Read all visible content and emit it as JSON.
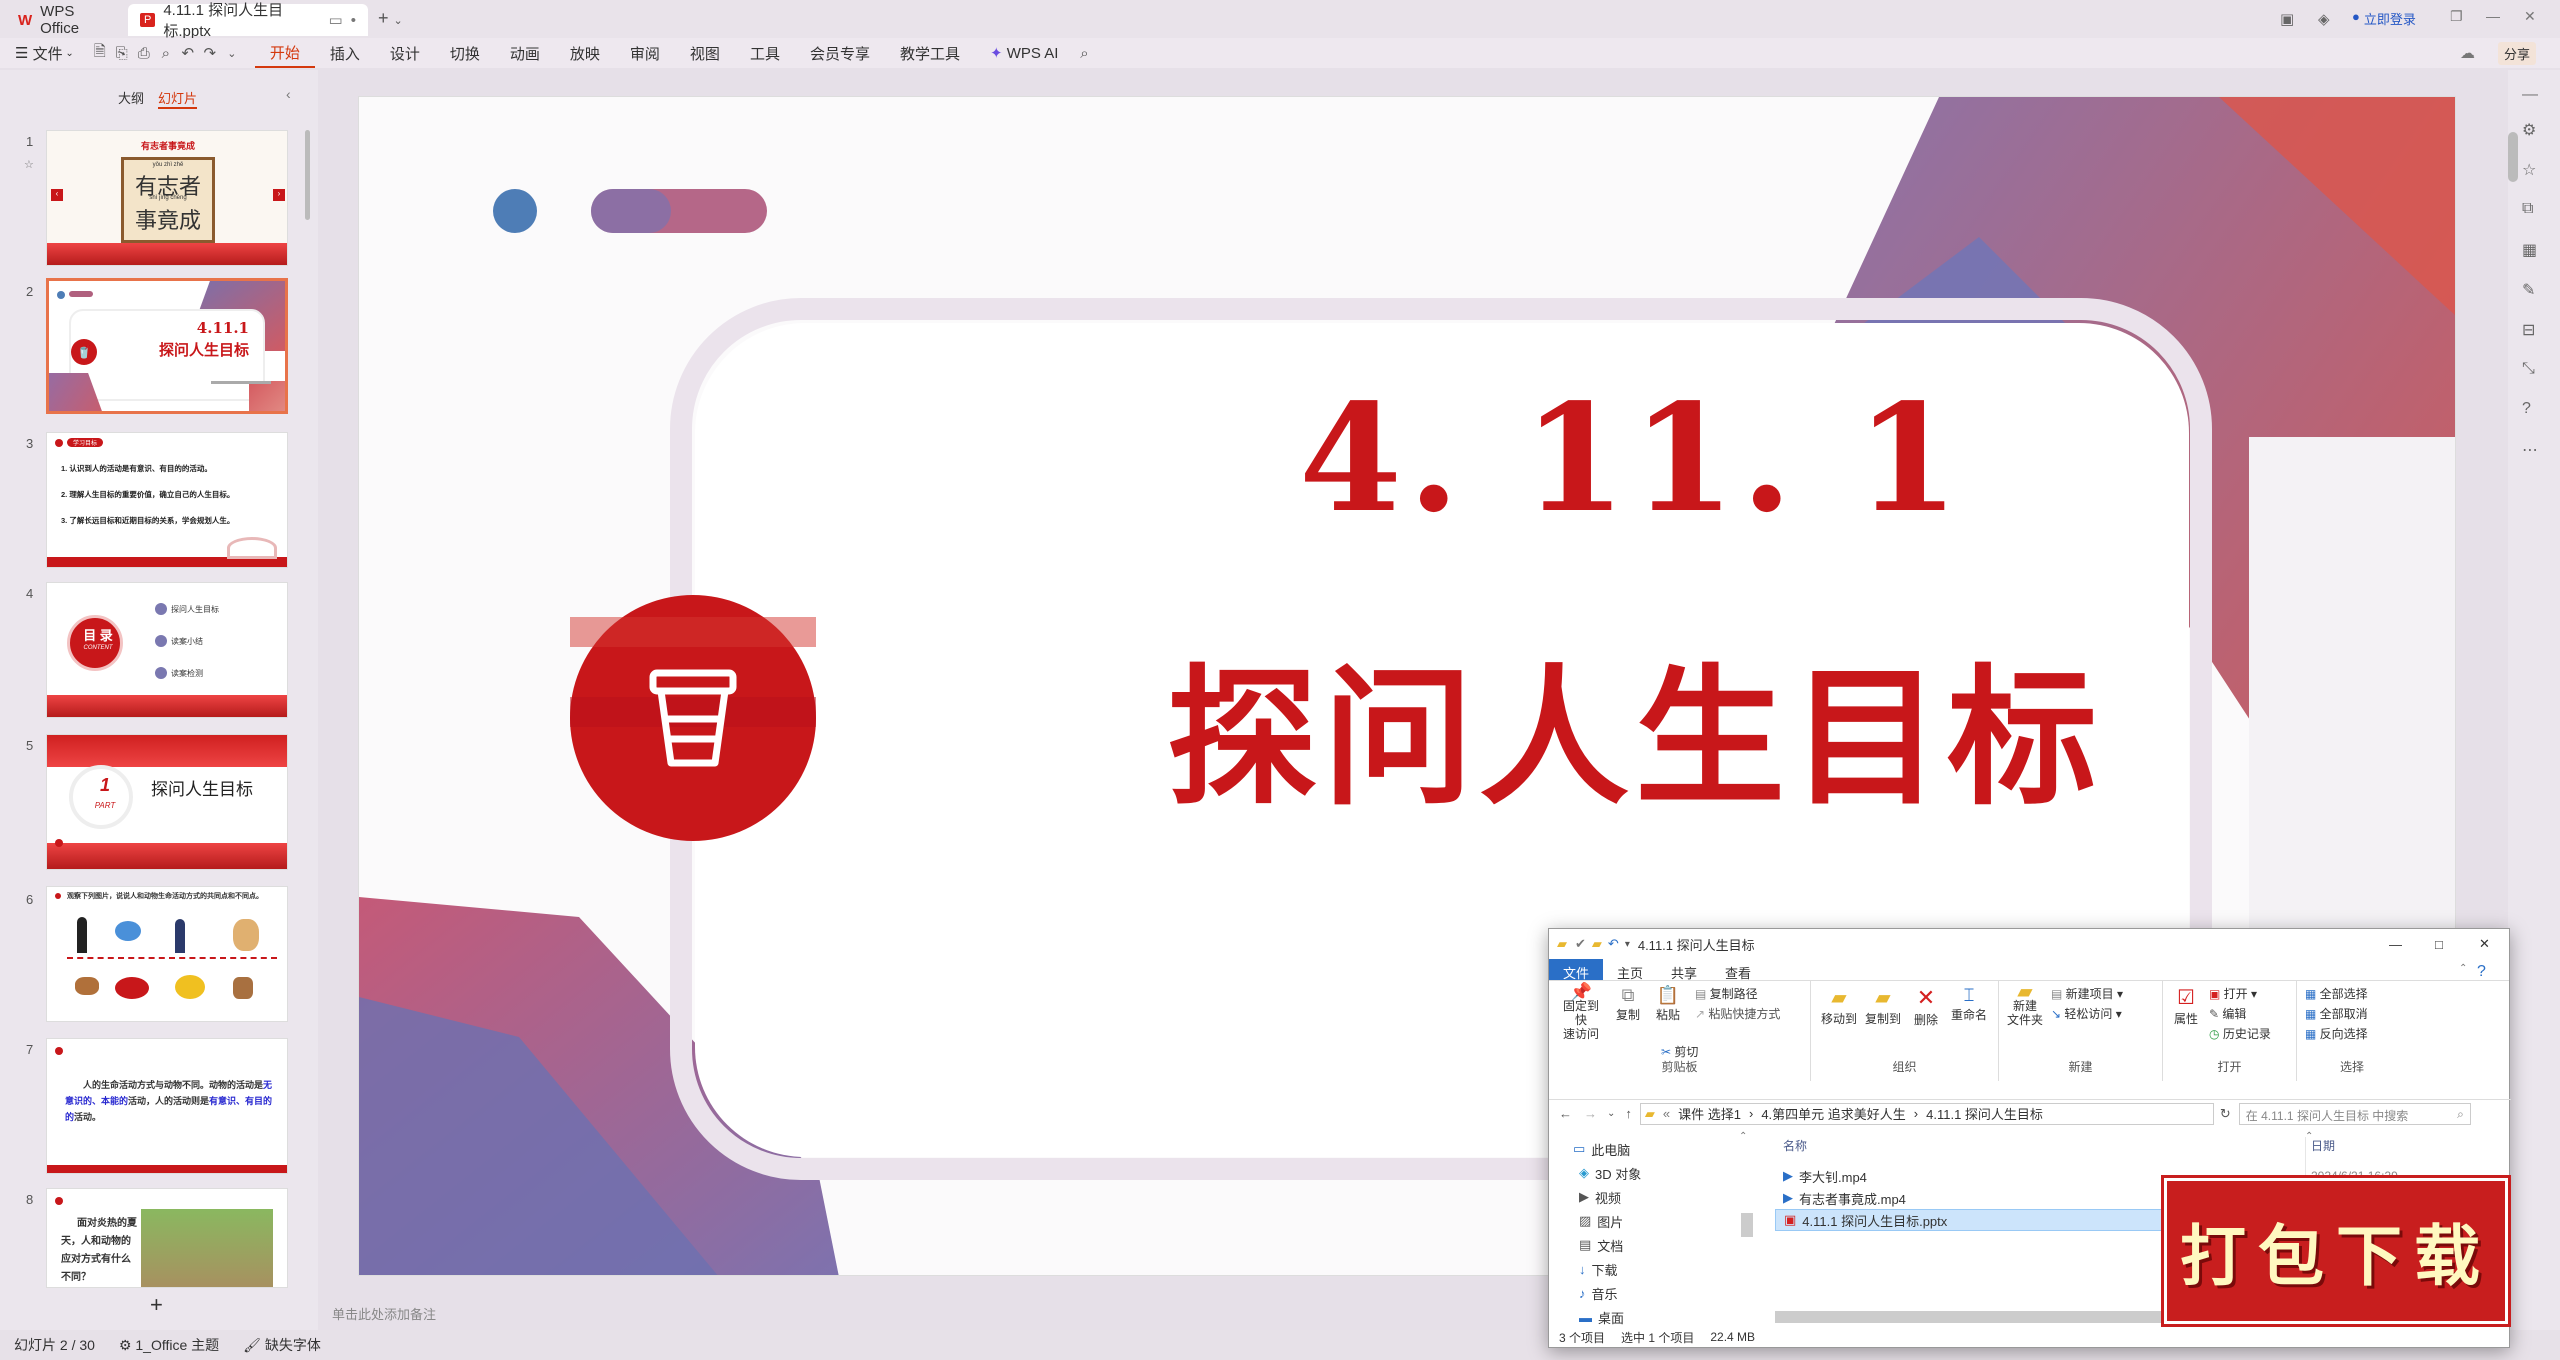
{
  "titlebar": {
    "app_tab": "WPS Office",
    "doc_tab": "4.11.1 探问人生目标.pptx",
    "login": "立即登录"
  },
  "ribbon": {
    "file": "文件",
    "tabs": [
      "开始",
      "插入",
      "设计",
      "切换",
      "动画",
      "放映",
      "审阅",
      "视图",
      "工具",
      "会员专享",
      "教学工具"
    ],
    "wps_ai": "WPS AI",
    "share": "分享"
  },
  "panel": {
    "outline": "大纲",
    "slides": "幻灯片",
    "add": "+"
  },
  "thumbs": [
    {
      "num": "1",
      "title": "有志者事竟成",
      "sub": "有志者",
      "sub2": "事竟成",
      "py": "yǒu zhì zhě",
      "py2": "shì jìng chéng"
    },
    {
      "num": "2",
      "t1": "4.11.1",
      "t2": "探问人生目标"
    },
    {
      "num": "3",
      "badge": "学习目标",
      "lines": [
        "1. 认识到人的活动是有意识、有目的的活动。",
        "2. 理解人生目标的重要价值，确立自己的人生目标。",
        "3. 了解长远目标和近期目标的关系，学会规划人生。"
      ]
    },
    {
      "num": "4",
      "mulu": "目 录",
      "content": "CONTENT",
      "items": [
        "探问人生目标",
        "读案小结",
        "读案检测"
      ]
    },
    {
      "num": "5",
      "part": "1",
      "part_word": "PART",
      "title": "探问人生目标"
    },
    {
      "num": "6",
      "text": "观察下列图片，说说人和动物生命活动方式的共同点和不同点。"
    },
    {
      "num": "7",
      "p1": "人的生命活动方式与动物不同。动物的活动是",
      "h1": "无意识的、本能的",
      "p2": "活动，人的活动则是",
      "h2": "有意识、有目的的",
      "p3": "活动。"
    },
    {
      "num": "8",
      "text": "面对炎热的夏天，人和动物的应对方式有什么不同？"
    }
  ],
  "slide": {
    "line1": "4. 11. 1",
    "line2": "探问人生目标",
    "notes": "单击此处添加备注"
  },
  "status": {
    "slide_count": "幻灯片 2 / 30",
    "theme": "1_Office 主题",
    "font": "缺失字体"
  },
  "explorer": {
    "title": "4.11.1 探问人生目标",
    "tabs": [
      "文件",
      "主页",
      "共享",
      "查看"
    ],
    "groups": {
      "clipboard": {
        "label": "剪贴板",
        "pin": "固定到快\n速访问",
        "copy": "复制",
        "paste": "粘贴",
        "cut": "剪切",
        "copy_path": "复制路径",
        "paste_shortcut": "粘贴快捷方式"
      },
      "organize": {
        "label": "组织",
        "move": "移动到",
        "copyto": "复制到",
        "delete": "删除",
        "rename": "重命名"
      },
      "new": {
        "label": "新建",
        "folder": "新建\n文件夹",
        "new_item": "新建项目",
        "easy": "轻松访问"
      },
      "open": {
        "label": "打开",
        "props": "属性",
        "open": "打开",
        "edit": "编辑",
        "history": "历史记录"
      },
      "select": {
        "label": "选择",
        "all": "全部选择",
        "none": "全部取消",
        "invert": "反向选择"
      }
    },
    "path": [
      "课件 选择1",
      "4.第四单元 追求美好人生",
      "4.11.1 探问人生目标"
    ],
    "search": "在 4.11.1 探问人生目标 中搜索",
    "nav": [
      "此电脑",
      "3D 对象",
      "视频",
      "图片",
      "文档",
      "下载",
      "音乐",
      "桌面"
    ],
    "col_name": "名称",
    "col_date": "日期",
    "files": [
      "李大钊.mp4",
      "有志者事竟成.mp4",
      "4.11.1 探问人生目标.pptx"
    ],
    "date_partial": "2024/6/21 16:29",
    "status": [
      "3 个项目",
      "选中 1 个项目",
      "22.4 MB"
    ]
  },
  "promo": {
    "text": "打包下载"
  },
  "colors": {
    "accent": "#d4380d",
    "slide_red": "#c8171a",
    "purple": "#8a6c9e",
    "explorer_blue": "#2a6fc7"
  }
}
